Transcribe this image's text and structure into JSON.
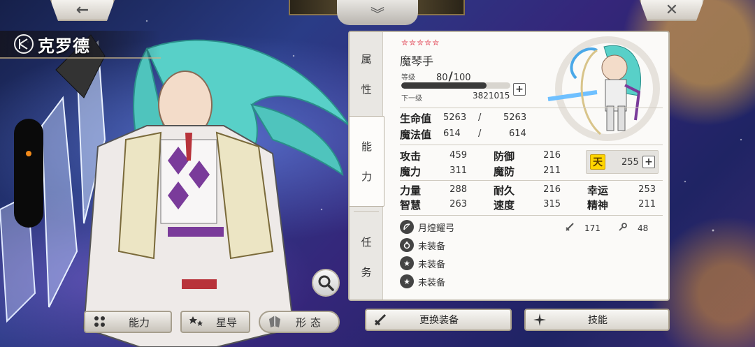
{
  "hero": {
    "name": "克罗德"
  },
  "nav": {
    "back_icon": "←",
    "close_icon": "✕",
    "collapse_icon": "︾"
  },
  "bottom_left": {
    "ability_label": "能力",
    "star_label": "星导",
    "form_label": "形态"
  },
  "tabs": {
    "attr": [
      "属",
      "性"
    ],
    "ability": [
      "能",
      "力"
    ],
    "quest": [
      "任",
      "务"
    ]
  },
  "profile": {
    "stars": "✮✮✮✮✮",
    "class_name": "魔琴手",
    "level_label": "等级",
    "level": "80",
    "level_max": "100",
    "next_label": "下一级",
    "next_exp": "3821015",
    "exp_fill_ratio": 0.78
  },
  "hp": {
    "label": "生命值",
    "value": "5263",
    "slash": "/",
    "max": "5263"
  },
  "mp": {
    "label": "魔法值",
    "value": "614",
    "slash": "/",
    "max": "614"
  },
  "stats": {
    "atk": {
      "label": "攻击",
      "value": "459"
    },
    "def": {
      "label": "防御",
      "value": "216"
    },
    "mag": {
      "label": "魔力",
      "value": "311"
    },
    "mdef": {
      "label": "魔防",
      "value": "211"
    },
    "str": {
      "label": "力量",
      "value": "288"
    },
    "sta": {
      "label": "耐久",
      "value": "216"
    },
    "luck": {
      "label": "幸运",
      "value": "253"
    },
    "wis": {
      "label": "智慧",
      "value": "263"
    },
    "spd": {
      "label": "速度",
      "value": "315"
    },
    "spirit": {
      "label": "精神",
      "value": "211"
    }
  },
  "sky": {
    "icon_text": "天",
    "value": "255"
  },
  "equipment": {
    "weapon": {
      "name": "月煌耀弓",
      "attack": "171",
      "range": "48"
    },
    "slot1": "未装备",
    "slot2": "未装备",
    "slot3": "未装备"
  },
  "actions": {
    "change_equipment": "更换装备",
    "skills": "技能"
  },
  "colors": {
    "star_red": "#e24a5a",
    "slider_dot": "#f28a1a",
    "sky_yellow": "#ffd400"
  }
}
